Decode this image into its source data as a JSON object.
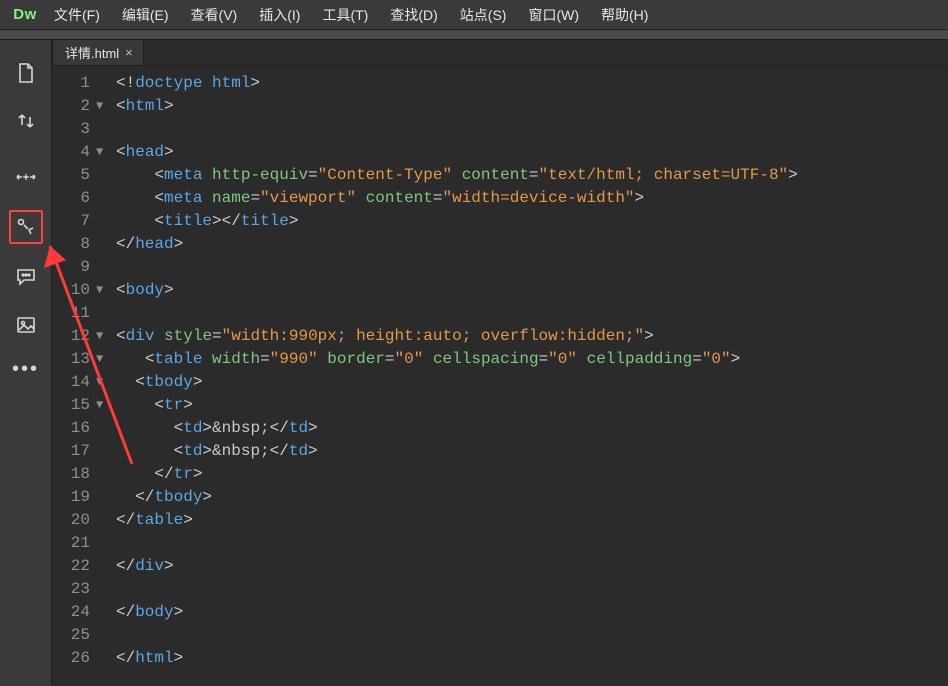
{
  "app_logo": "Dw",
  "menu": [
    "文件(F)",
    "编辑(E)",
    "查看(V)",
    "插入(I)",
    "工具(T)",
    "查找(D)",
    "站点(S)",
    "窗口(W)",
    "帮助(H)"
  ],
  "tab": {
    "name": "详情.html",
    "close": "×"
  },
  "toolrail_icons": {
    "top1": "file-icon",
    "top2": "updown-arrows-icon",
    "mid1": "star-arrows-icon",
    "mid2_highlighted": "distribute-icon",
    "mid3": "chat-icon",
    "mid4": "image-icon",
    "dots": "more-icon"
  },
  "code_lines": [
    {
      "n": 1,
      "fold": "",
      "seg": [
        [
          "p",
          "<!"
        ],
        [
          "t",
          "doctype html"
        ],
        [
          "p",
          ">"
        ]
      ]
    },
    {
      "n": 2,
      "fold": "▼",
      "seg": [
        [
          "p",
          "<"
        ],
        [
          "t",
          "html"
        ],
        [
          "p",
          ">"
        ]
      ]
    },
    {
      "n": 3,
      "fold": "",
      "seg": []
    },
    {
      "n": 4,
      "fold": "▼",
      "seg": [
        [
          "p",
          "<"
        ],
        [
          "t",
          "head"
        ],
        [
          "p",
          ">"
        ]
      ]
    },
    {
      "n": 5,
      "fold": "",
      "seg": [
        [
          "sp",
          "    "
        ],
        [
          "p",
          "<"
        ],
        [
          "t",
          "meta"
        ],
        [
          "sp",
          " "
        ],
        [
          "a",
          "http-equiv"
        ],
        [
          "p",
          "="
        ],
        [
          "s",
          "\"Content-Type\""
        ],
        [
          "sp",
          " "
        ],
        [
          "a",
          "content"
        ],
        [
          "p",
          "="
        ],
        [
          "s",
          "\"text/html; charset=UTF-8\""
        ],
        [
          "p",
          ">"
        ]
      ]
    },
    {
      "n": 6,
      "fold": "",
      "seg": [
        [
          "sp",
          "    "
        ],
        [
          "p",
          "<"
        ],
        [
          "t",
          "meta"
        ],
        [
          "sp",
          " "
        ],
        [
          "a",
          "name"
        ],
        [
          "p",
          "="
        ],
        [
          "s",
          "\"viewport\""
        ],
        [
          "sp",
          " "
        ],
        [
          "a",
          "content"
        ],
        [
          "p",
          "="
        ],
        [
          "s",
          "\"width=device-width\""
        ],
        [
          "p",
          ">"
        ]
      ]
    },
    {
      "n": 7,
      "fold": "",
      "seg": [
        [
          "sp",
          "    "
        ],
        [
          "p",
          "<"
        ],
        [
          "t",
          "title"
        ],
        [
          "p",
          "></"
        ],
        [
          "t",
          "title"
        ],
        [
          "p",
          ">"
        ]
      ]
    },
    {
      "n": 8,
      "fold": "",
      "seg": [
        [
          "p",
          "</"
        ],
        [
          "t",
          "head"
        ],
        [
          "p",
          ">"
        ]
      ]
    },
    {
      "n": 9,
      "fold": "",
      "seg": []
    },
    {
      "n": 10,
      "fold": "▼",
      "seg": [
        [
          "p",
          "<"
        ],
        [
          "t",
          "body"
        ],
        [
          "p",
          ">"
        ]
      ]
    },
    {
      "n": 11,
      "fold": "",
      "seg": []
    },
    {
      "n": 12,
      "fold": "▼",
      "seg": [
        [
          "p",
          "<"
        ],
        [
          "t",
          "div"
        ],
        [
          "sp",
          " "
        ],
        [
          "a",
          "style"
        ],
        [
          "p",
          "="
        ],
        [
          "s",
          "\"width:990px; height:auto; overflow:hidden;\""
        ],
        [
          "p",
          ">"
        ]
      ]
    },
    {
      "n": 13,
      "fold": "▼",
      "seg": [
        [
          "sp",
          "   "
        ],
        [
          "p",
          "<"
        ],
        [
          "t",
          "table"
        ],
        [
          "sp",
          " "
        ],
        [
          "a",
          "width"
        ],
        [
          "p",
          "="
        ],
        [
          "s",
          "\"990\""
        ],
        [
          "sp",
          " "
        ],
        [
          "a",
          "border"
        ],
        [
          "p",
          "="
        ],
        [
          "s",
          "\"0\""
        ],
        [
          "sp",
          " "
        ],
        [
          "a",
          "cellspacing"
        ],
        [
          "p",
          "="
        ],
        [
          "s",
          "\"0\""
        ],
        [
          "sp",
          " "
        ],
        [
          "a",
          "cellpadding"
        ],
        [
          "p",
          "="
        ],
        [
          "s",
          "\"0\""
        ],
        [
          "p",
          ">"
        ]
      ]
    },
    {
      "n": 14,
      "fold": "▼",
      "seg": [
        [
          "sp",
          "  "
        ],
        [
          "p",
          "<"
        ],
        [
          "t",
          "tbody"
        ],
        [
          "p",
          ">"
        ]
      ]
    },
    {
      "n": 15,
      "fold": "▼",
      "seg": [
        [
          "sp",
          "    "
        ],
        [
          "p",
          "<"
        ],
        [
          "t",
          "tr"
        ],
        [
          "p",
          ">"
        ]
      ]
    },
    {
      "n": 16,
      "fold": "",
      "seg": [
        [
          "sp",
          "      "
        ],
        [
          "p",
          "<"
        ],
        [
          "t",
          "td"
        ],
        [
          "p",
          ">"
        ],
        [
          "e",
          "&nbsp;"
        ],
        [
          "p",
          "</"
        ],
        [
          "t",
          "td"
        ],
        [
          "p",
          ">"
        ]
      ]
    },
    {
      "n": 17,
      "fold": "",
      "seg": [
        [
          "sp",
          "      "
        ],
        [
          "p",
          "<"
        ],
        [
          "t",
          "td"
        ],
        [
          "p",
          ">"
        ],
        [
          "e",
          "&nbsp;"
        ],
        [
          "p",
          "</"
        ],
        [
          "t",
          "td"
        ],
        [
          "p",
          ">"
        ]
      ]
    },
    {
      "n": 18,
      "fold": "",
      "seg": [
        [
          "sp",
          "    "
        ],
        [
          "p",
          "</"
        ],
        [
          "t",
          "tr"
        ],
        [
          "p",
          ">"
        ]
      ]
    },
    {
      "n": 19,
      "fold": "",
      "seg": [
        [
          "sp",
          "  "
        ],
        [
          "p",
          "</"
        ],
        [
          "t",
          "tbody"
        ],
        [
          "p",
          ">"
        ]
      ]
    },
    {
      "n": 20,
      "fold": "",
      "seg": [
        [
          "p",
          "</"
        ],
        [
          "t",
          "table"
        ],
        [
          "p",
          ">"
        ]
      ]
    },
    {
      "n": 21,
      "fold": "",
      "seg": []
    },
    {
      "n": 22,
      "fold": "",
      "seg": [
        [
          "p",
          "</"
        ],
        [
          "t",
          "div"
        ],
        [
          "p",
          ">"
        ]
      ]
    },
    {
      "n": 23,
      "fold": "",
      "seg": []
    },
    {
      "n": 24,
      "fold": "",
      "seg": [
        [
          "p",
          "</"
        ],
        [
          "t",
          "body"
        ],
        [
          "p",
          ">"
        ]
      ]
    },
    {
      "n": 25,
      "fold": "",
      "seg": []
    },
    {
      "n": 26,
      "fold": "",
      "seg": [
        [
          "p",
          "</"
        ],
        [
          "t",
          "html"
        ],
        [
          "p",
          ">"
        ]
      ]
    }
  ]
}
